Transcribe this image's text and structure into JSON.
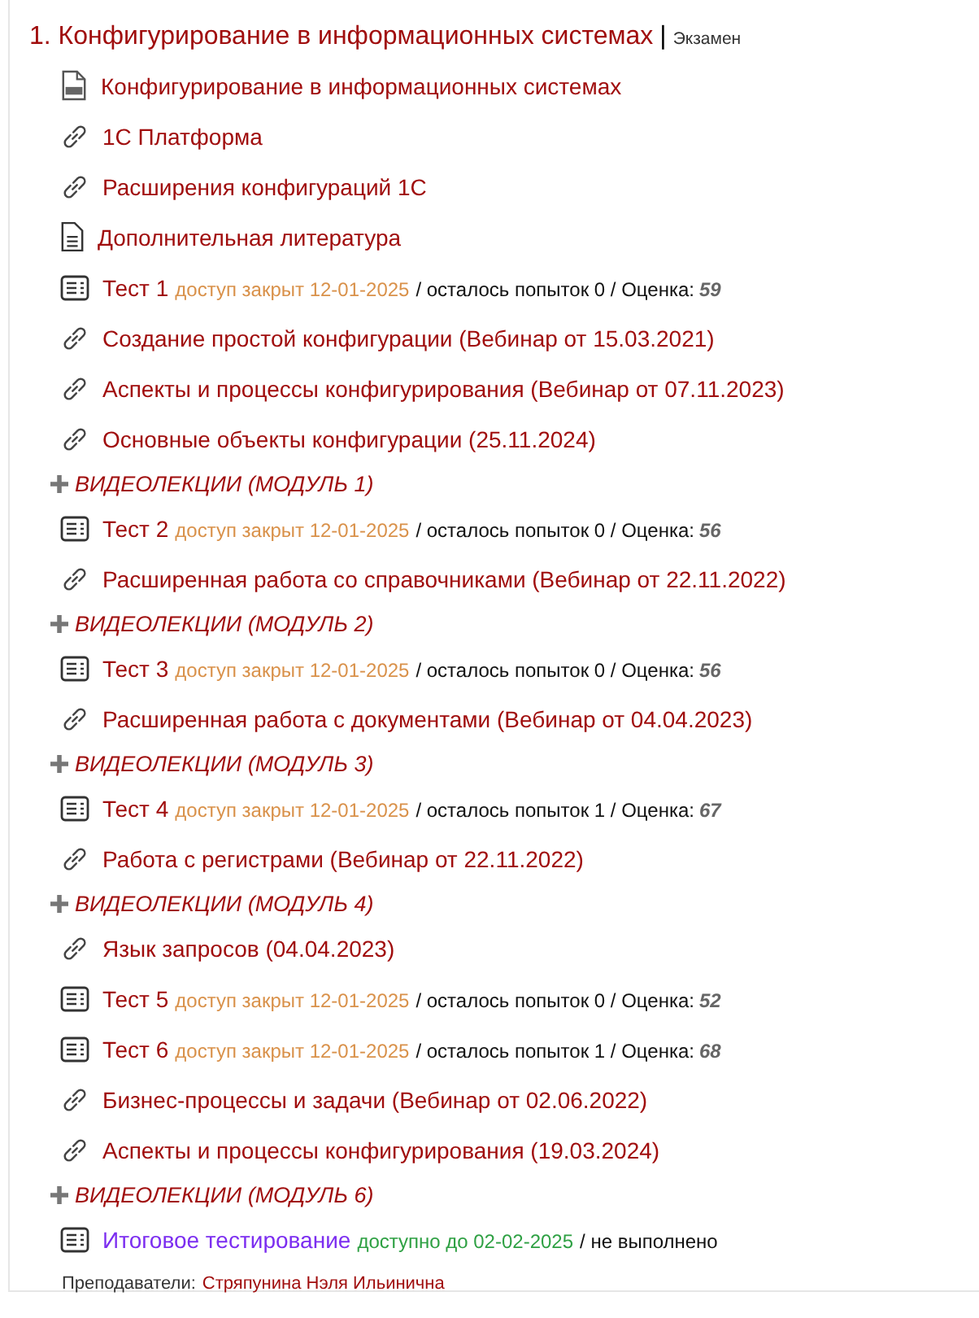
{
  "course": {
    "number": "1.",
    "title": "Конфигурирование в информационных системах",
    "separator": "|",
    "assessment": "Экзамен"
  },
  "items": [
    {
      "kind": "pdf",
      "label": "Конфигурирование в информационных системах",
      "visited": false
    },
    {
      "kind": "link",
      "label": "1С Платформа",
      "visited": false
    },
    {
      "kind": "link",
      "label": "Расширения конфигураций 1С",
      "visited": false
    },
    {
      "kind": "doc",
      "label": "Дополнительная литература",
      "visited": false
    },
    {
      "kind": "quiz",
      "label": "Тест 1",
      "visited": false,
      "status": "доступ закрыт 12-01-2025",
      "available": false,
      "info": "/ осталось попыток 0 / Оценка:",
      "grade": "59"
    },
    {
      "kind": "link",
      "label": "Создание простой конфигурации (Вебинар от 15.03.2021)",
      "visited": false
    },
    {
      "kind": "link",
      "label": "Аспекты и процессы конфигурирования (Вебинар от 07.11.2023)",
      "visited": false
    },
    {
      "kind": "link",
      "label": "Основные объекты конфигурации (25.11.2024)",
      "visited": false
    },
    {
      "kind": "section",
      "label": "ВИДЕОЛЕКЦИИ (МОДУЛЬ 1)",
      "expanded": false
    },
    {
      "kind": "quiz",
      "label": "Тест 2",
      "visited": false,
      "status": "доступ закрыт 12-01-2025",
      "available": false,
      "info": "/ осталось попыток 0 / Оценка:",
      "grade": "56"
    },
    {
      "kind": "link",
      "label": "Расширенная работа со справочниками (Вебинар от 22.11.2022)",
      "visited": false
    },
    {
      "kind": "section",
      "label": "ВИДЕОЛЕКЦИИ (МОДУЛЬ 2)",
      "expanded": false
    },
    {
      "kind": "quiz",
      "label": "Тест 3",
      "visited": false,
      "status": "доступ закрыт 12-01-2025",
      "available": false,
      "info": "/ осталось попыток 0 / Оценка:",
      "grade": "56"
    },
    {
      "kind": "link",
      "label": "Расширенная работа с документами (Вебинар от 04.04.2023)",
      "visited": false
    },
    {
      "kind": "section",
      "label": "ВИДЕОЛЕКЦИИ (МОДУЛЬ 3)",
      "expanded": false
    },
    {
      "kind": "quiz",
      "label": "Тест 4",
      "visited": false,
      "status": "доступ закрыт 12-01-2025",
      "available": false,
      "info": "/ осталось попыток 1 / Оценка:",
      "grade": "67"
    },
    {
      "kind": "link",
      "label": "Работа с регистрами (Вебинар от 22.11.2022)",
      "visited": false
    },
    {
      "kind": "section",
      "label": "ВИДЕОЛЕКЦИИ (МОДУЛЬ 4)",
      "expanded": false
    },
    {
      "kind": "link",
      "label": "Язык запросов (04.04.2023)",
      "visited": false
    },
    {
      "kind": "quiz",
      "label": "Тест 5",
      "visited": false,
      "status": "доступ закрыт 12-01-2025",
      "available": false,
      "info": "/ осталось попыток 0 / Оценка:",
      "grade": "52"
    },
    {
      "kind": "quiz",
      "label": "Тест 6",
      "visited": false,
      "status": "доступ закрыт 12-01-2025",
      "available": false,
      "info": "/ осталось попыток 1 / Оценка:",
      "grade": "68"
    },
    {
      "kind": "link",
      "label": "Бизнес-процессы и задачи (Вебинар от 02.06.2022)",
      "visited": false
    },
    {
      "kind": "link",
      "label": "Аспекты и процессы конфигурирования (19.03.2024)",
      "visited": false
    },
    {
      "kind": "section",
      "label": "ВИДЕОЛЕКЦИИ (МОДУЛЬ 6)",
      "expanded": false
    },
    {
      "kind": "quiz",
      "label": "Итоговое тестирование",
      "visited": true,
      "status": "доступно до 02-02-2025",
      "available": true,
      "info": "/ не выполнено"
    }
  ],
  "teachers": {
    "label": "Преподаватели:",
    "names": "Стряпунина Нэля Ильинична"
  }
}
